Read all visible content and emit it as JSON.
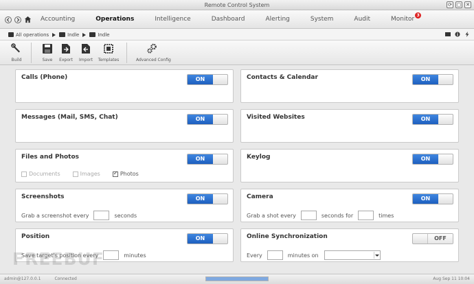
{
  "window": {
    "title": "Remote Control System"
  },
  "nav": {
    "tabs": [
      {
        "label": "Accounting"
      },
      {
        "label": "Operations"
      },
      {
        "label": "Intelligence"
      },
      {
        "label": "Dashboard"
      },
      {
        "label": "Alerting"
      },
      {
        "label": "System"
      },
      {
        "label": "Audit"
      },
      {
        "label": "Monitor",
        "badge": "3"
      }
    ],
    "active_tab": "Operations"
  },
  "breadcrumb": [
    {
      "label": "All operations"
    },
    {
      "label": "Indle"
    },
    {
      "label": "Indle"
    }
  ],
  "toolbar": {
    "build": "Build",
    "save": "Save",
    "export": "Export",
    "import": "Import",
    "templates": "Templates",
    "advanced": "Advanced Config"
  },
  "modules": {
    "calls": {
      "title": "Calls (Phone)",
      "state": "ON"
    },
    "contacts": {
      "title": "Contacts & Calendar",
      "state": "ON"
    },
    "messages": {
      "title": "Messages (Mail, SMS, Chat)",
      "state": "ON"
    },
    "websites": {
      "title": "Visited Websites",
      "state": "ON"
    },
    "files": {
      "title": "Files and Photos",
      "state": "ON",
      "options": [
        {
          "label": "Documents",
          "checked": false
        },
        {
          "label": "Images",
          "checked": false
        },
        {
          "label": "Photos",
          "checked": true
        }
      ]
    },
    "keylog": {
      "title": "Keylog",
      "state": "ON"
    },
    "screenshots": {
      "title": "Screenshots",
      "state": "ON",
      "prefix": "Grab a screenshot every",
      "suffix": "seconds"
    },
    "camera": {
      "title": "Camera",
      "state": "ON",
      "prefix": "Grab a shot every",
      "middle": "seconds for",
      "suffix": "times"
    },
    "position": {
      "title": "Position",
      "state": "ON",
      "prefix": "Save target's position every",
      "suffix": "minutes"
    },
    "sync": {
      "title": "Online Synchronization",
      "state": "OFF",
      "prefix": "Every",
      "middle": "minutes on"
    }
  },
  "status": {
    "left1": "admin@127.0.0.1",
    "left2": "Connected",
    "progress": 1.0,
    "right": "Aug Sep 11 10:04"
  },
  "watermark": "FREEBUF",
  "colors": {
    "accent": "#2a6fd1",
    "badge": "#dd2222"
  }
}
